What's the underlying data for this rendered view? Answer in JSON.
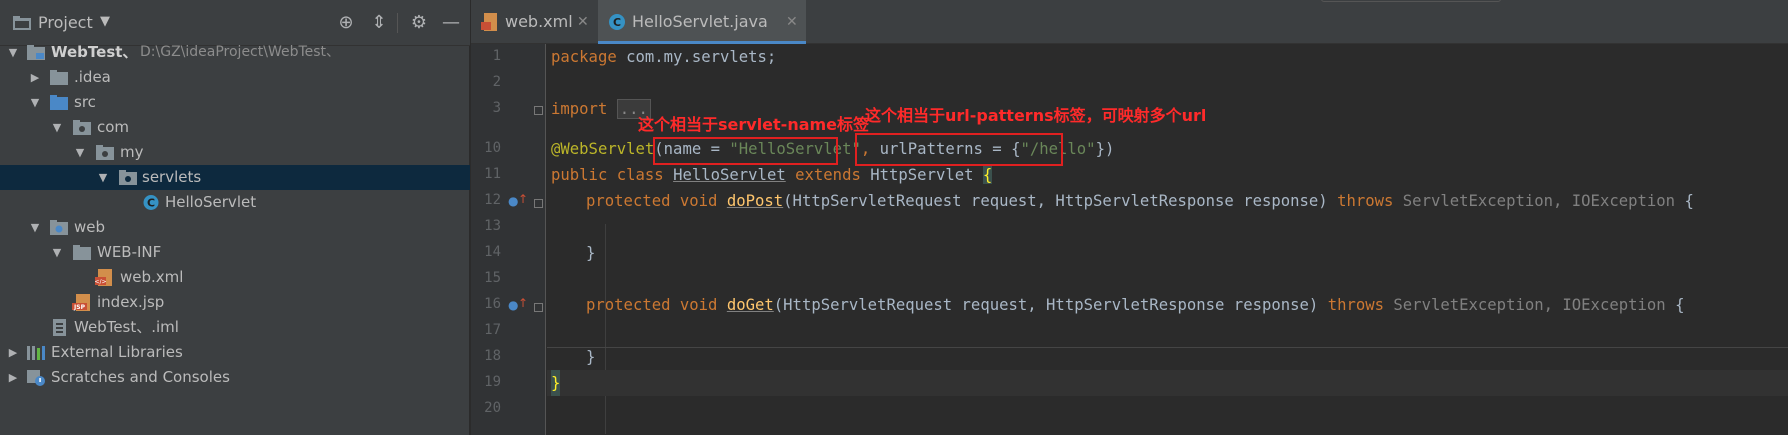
{
  "project_panel": {
    "title": "Project",
    "tree": [
      {
        "label": "WebTest、",
        "hint": "D:\\GZ\\ideaProject\\WebTest、",
        "icon": "module-folder-icon",
        "depth": 0,
        "expanded": true
      },
      {
        "label": ".idea",
        "icon": "folder-icon",
        "depth": 1,
        "expanded": false
      },
      {
        "label": "src",
        "icon": "source-folder-icon",
        "depth": 1,
        "expanded": true
      },
      {
        "label": "com",
        "icon": "package-icon",
        "depth": 2,
        "expanded": true
      },
      {
        "label": "my",
        "icon": "package-icon",
        "depth": 3,
        "expanded": true
      },
      {
        "label": "servlets",
        "icon": "package-icon",
        "depth": 4,
        "expanded": true,
        "selected": true
      },
      {
        "label": "HelloServlet",
        "icon": "java-class-icon",
        "depth": 5
      },
      {
        "label": "web",
        "icon": "web-folder-icon",
        "depth": 1,
        "expanded": true
      },
      {
        "label": "WEB-INF",
        "icon": "folder-icon",
        "depth": 2,
        "expanded": true
      },
      {
        "label": "web.xml",
        "icon": "xml-file-icon",
        "depth": 3
      },
      {
        "label": "index.jsp",
        "icon": "jsp-file-icon",
        "depth": 2
      },
      {
        "label": "WebTest、.iml",
        "icon": "iml-file-icon",
        "depth": 1
      },
      {
        "label": "External Libraries",
        "icon": "libraries-icon",
        "depth": 0,
        "expanded": false
      },
      {
        "label": "Scratches and Consoles",
        "icon": "scratches-icon",
        "depth": 0,
        "expanded": false
      }
    ]
  },
  "editor": {
    "tabs": [
      {
        "label": "web.xml",
        "icon": "xml-file-icon",
        "active": false
      },
      {
        "label": "HelloServlet.java",
        "icon": "java-class-icon",
        "active": true
      }
    ],
    "line_numbers": [
      "1",
      "2",
      "3",
      "10",
      "11",
      "12",
      "13",
      "14",
      "15",
      "16",
      "17",
      "18",
      "19",
      "20"
    ],
    "code": {
      "l1_kw": "package",
      "l1_rest": " com.my.servlets;",
      "l3_kw": "import",
      "l3_dots": "...",
      "l10_anno": "@WebServlet",
      "l10_p1": "(",
      "l10_name_key": "name",
      "l10_eq1": " = ",
      "l10_name_val": "\"HelloServlet\"",
      "l10_comma": ", ",
      "l10_url_key": "urlPatterns",
      "l10_eq2": " = {",
      "l10_url_val": "\"/hello\"",
      "l10_end": "})",
      "l11_kw": "public class ",
      "l11_cls": "HelloServlet",
      "l11_ext": " extends ",
      "l11_base": "HttpServlet ",
      "l11_brace": "{",
      "l12_kw": "protected void ",
      "l12_fn": "doPost",
      "l12_args": "(HttpServletRequest request, HttpServletResponse response) ",
      "l12_throws": "throws ",
      "l12_ex": "ServletException, IOException ",
      "l12_brace": "{",
      "l14": "}",
      "l16_kw": "protected void ",
      "l16_fn": "doGet",
      "l16_args": "(HttpServletRequest request, HttpServletResponse response) ",
      "l16_throws": "throws ",
      "l16_ex": "ServletException, IOException ",
      "l16_brace": "{",
      "l18": "}",
      "l19": "}"
    }
  },
  "annotations": {
    "servlet_name_note": "这个相当于servlet-name标签",
    "url_patterns_note": "这个相当于url-patterns标签，可映射多个url"
  },
  "colors": {
    "keyword": "#cc7832",
    "annotation": "#bbb529",
    "string": "#6a8759",
    "method": "#ffc66d",
    "highlight_red": "#e02020"
  }
}
